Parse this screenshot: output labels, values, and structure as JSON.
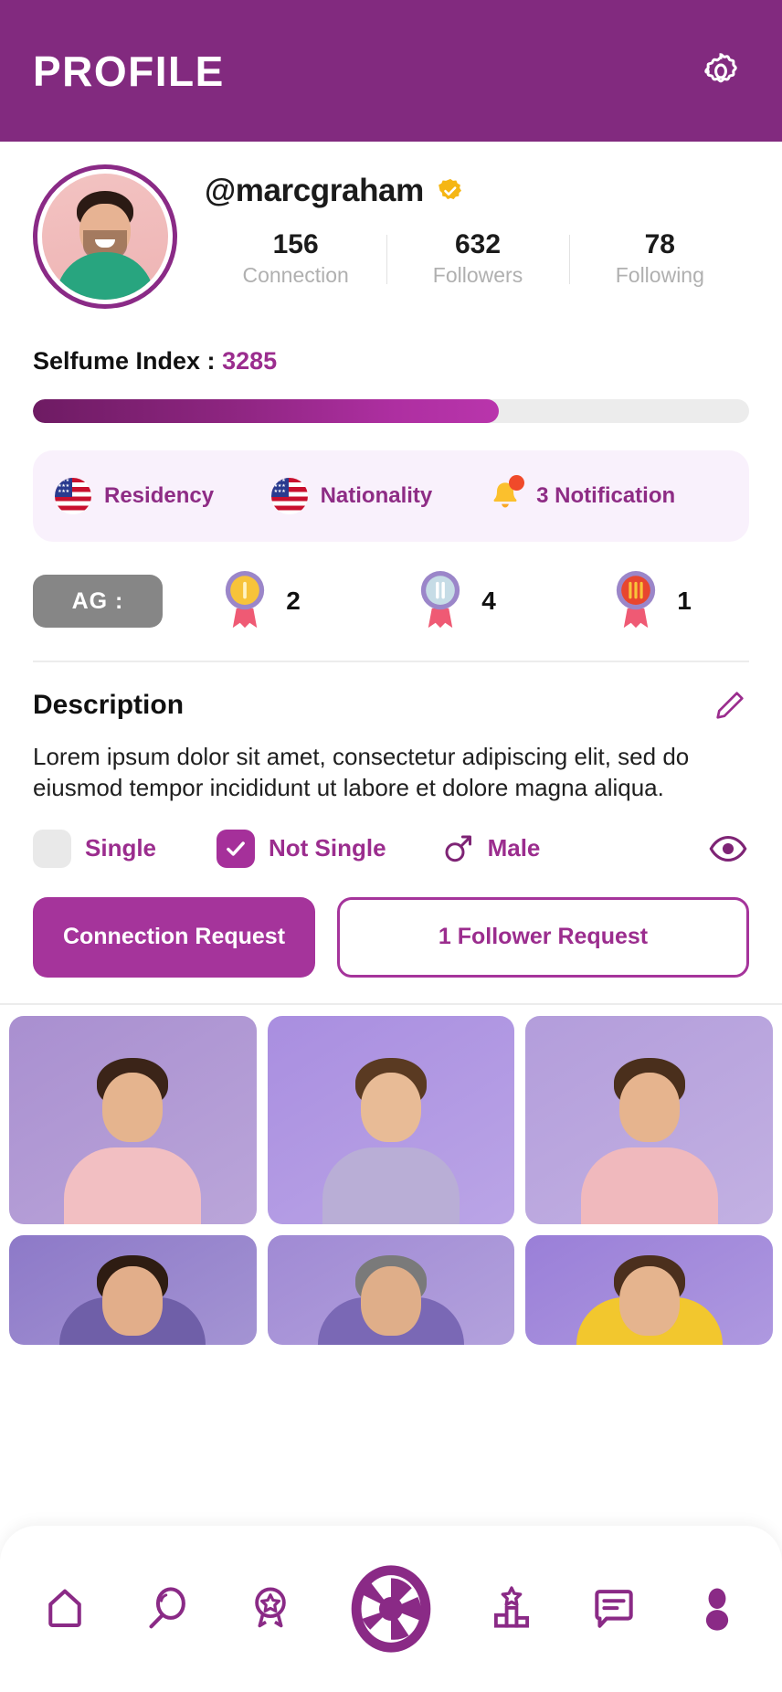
{
  "header": {
    "title": "PROFILE",
    "settings_icon": "gear-icon"
  },
  "profile": {
    "username": "@marcgraham",
    "verified_icon": "verified-badge-icon",
    "avatar_icon": "user-avatar",
    "stats": [
      {
        "value": "156",
        "label": "Connection"
      },
      {
        "value": "632",
        "label": "Followers"
      },
      {
        "value": "78",
        "label": "Following"
      }
    ]
  },
  "index": {
    "label": "Selfume Index :",
    "value": "3285",
    "progress_percent": 65,
    "fill_color": "#8D2580",
    "track_color": "#ececec"
  },
  "chips": [
    {
      "icon": "us-flag-icon",
      "label": "Residency"
    },
    {
      "icon": "us-flag-icon",
      "label": "Nationality"
    },
    {
      "icon": "bell-icon",
      "label": "3 Notification",
      "badge": true
    }
  ],
  "medals": {
    "ag_label": "AG :",
    "items": [
      {
        "icon": "gold-medal-icon",
        "rank": "I",
        "count": "2",
        "color": "#F7C33A"
      },
      {
        "icon": "silver-medal-icon",
        "rank": "II",
        "count": "4",
        "color": "#C6DCE6"
      },
      {
        "icon": "bronze-medal-icon",
        "rank": "III",
        "count": "1",
        "color": "#E8462F"
      }
    ]
  },
  "description": {
    "title": "Description",
    "edit_icon": "pencil-icon",
    "text": "Lorem ipsum dolor sit amet, consectetur adipiscing elit, sed do eiusmod tempor incididunt ut labore et dolore magna aliqua."
  },
  "status": {
    "single_label": "Single",
    "single_checked": false,
    "not_single_label": "Not Single",
    "not_single_checked": true,
    "gender_icon": "male-symbol-icon",
    "gender_label": "Male",
    "visibility_icon": "eye-icon"
  },
  "actions": {
    "connection_request": "Connection Request",
    "follower_request": "1 Follower Request"
  },
  "photo_grid": {
    "tiles": [
      {
        "name": "photo-man-phone",
        "bg": "#a98fd0",
        "shirt": "#f2bfc2",
        "hair": "#3b2418",
        "skin": "#e5b48e"
      },
      {
        "name": "photo-teen-glasses",
        "bg": "#a98ee0",
        "shirt": "#b9aed6",
        "hair": "#5a3a22",
        "skin": "#e8bb96"
      },
      {
        "name": "photo-man-surprise",
        "bg": "#b39ddb",
        "shirt": "#f0b9bd",
        "hair": "#4a2f1c",
        "skin": "#e6b48e"
      },
      {
        "name": "photo-man-excited",
        "bg": "#8d79c8",
        "shirt": "#6f5fa8",
        "hair": "#2e1c12",
        "skin": "#e2ae8a"
      },
      {
        "name": "photo-man-beard",
        "bg": "#a08ad4",
        "shirt": "#7a68b5",
        "hair": "#7a7a7a",
        "skin": "#dfae89"
      },
      {
        "name": "photo-man-yellow",
        "bg": "#9a7fd8",
        "shirt": "#f2c72e",
        "hair": "#4b2f1d",
        "skin": "#e5b48e"
      }
    ]
  },
  "bottom_nav": {
    "items": [
      {
        "icon": "home-icon",
        "name": "nav-home"
      },
      {
        "icon": "search-icon",
        "name": "nav-search"
      },
      {
        "icon": "award-icon",
        "name": "nav-awards"
      },
      {
        "icon": "camera-shutter-icon",
        "name": "nav-camera",
        "center": true
      },
      {
        "icon": "podium-star-icon",
        "name": "nav-leaderboard"
      },
      {
        "icon": "chat-icon",
        "name": "nav-messages"
      },
      {
        "icon": "person-icon",
        "name": "nav-profile"
      }
    ]
  },
  "theme": {
    "header_purple": "#822A7F",
    "accent_purple": "#9B2D8E",
    "button_purple": "#A5349B",
    "chip_bg": "#F9F1FC"
  }
}
